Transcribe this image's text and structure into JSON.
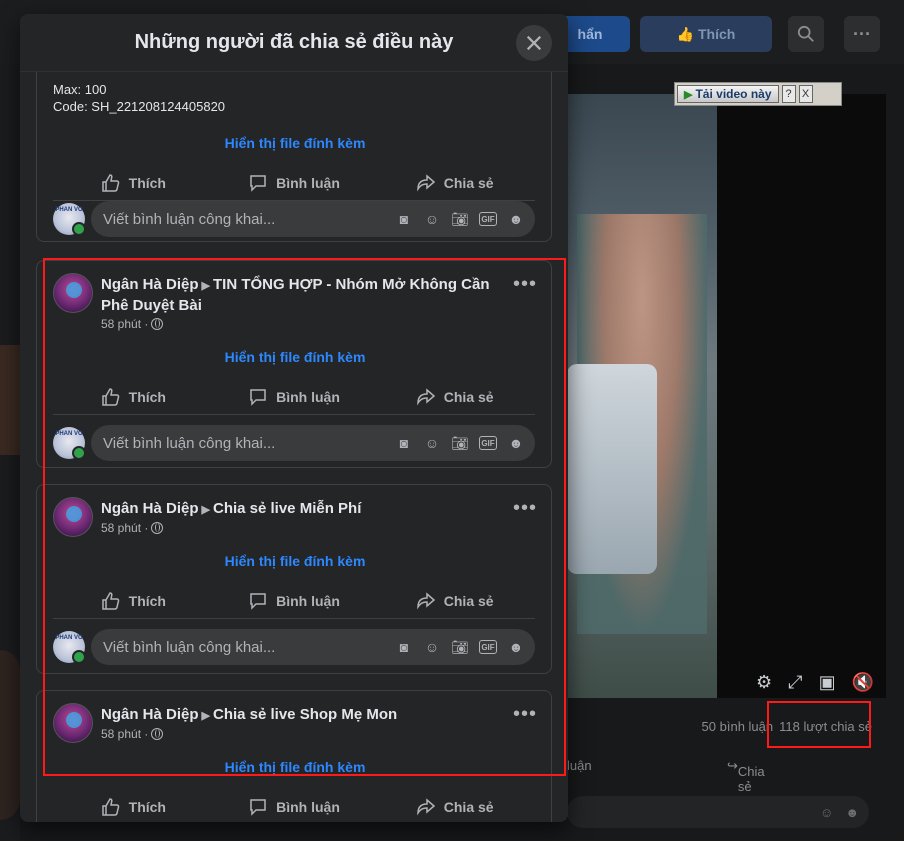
{
  "background": {
    "top_buttons": {
      "blue_label": "hẩn",
      "like_label": "Thích"
    },
    "download_widget": {
      "label": "Tải video này",
      "help": "?",
      "close": "X"
    },
    "stats": {
      "comments": "50 bình luận",
      "shares": "118 lượt chia sẻ"
    },
    "actions": {
      "comment_partial": "luận",
      "share": "Chia sẻ"
    }
  },
  "modal": {
    "title": "Những người đã chia sẻ điều này",
    "close_icon": "close-icon"
  },
  "top_card": {
    "line1": "Max: 100",
    "line2": "Code: SH_221208124405820",
    "attachment": "Hiển thị file đính kèm"
  },
  "common": {
    "like": "Thích",
    "comment": "Bình luận",
    "share": "Chia sẻ",
    "comment_placeholder": "Viết bình luận công khai...",
    "me_avatar_text": "PHAN VO",
    "attachment": "Hiển thị file đính kèm"
  },
  "posts": [
    {
      "author": "Ngân Hà Diệp",
      "group": "TIN TỔNG HỢP - Nhóm Mở Không Cần",
      "group_line2": "Phê Duyệt Bài",
      "time": "58 phút ·"
    },
    {
      "author": "Ngân Hà Diệp",
      "group": "Chia sẻ live Miễn Phí",
      "time": "58 phút ·"
    },
    {
      "author": "Ngân Hà Diệp",
      "group": "Chia sẻ live Shop Mẹ Mon",
      "time": "58 phút ·"
    }
  ]
}
